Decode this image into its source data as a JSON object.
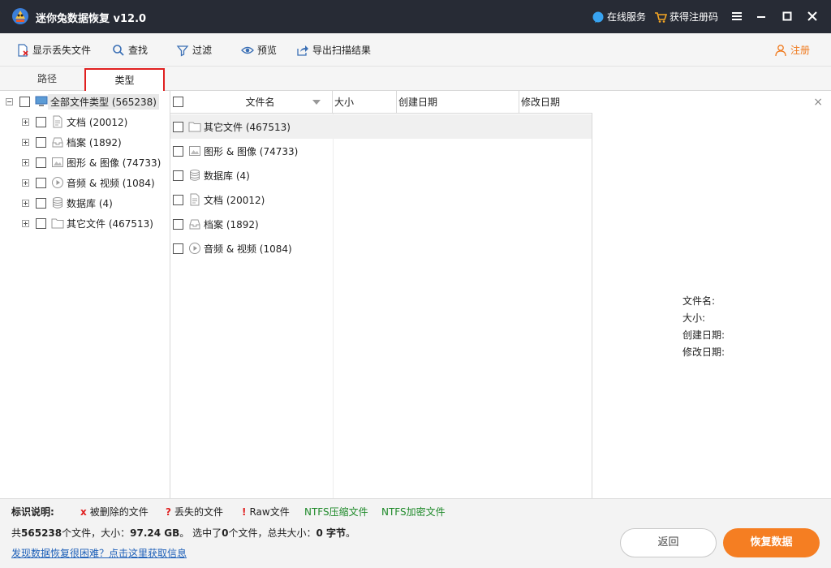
{
  "titlebar": {
    "title": "迷你兔数据恢复 v12.0",
    "online_service": "在线服务",
    "get_code": "获得注册码"
  },
  "toolbar": {
    "show_lost": "显示丢失文件",
    "find": "查找",
    "filter": "过滤",
    "preview": "预览",
    "export": "导出扫描结果",
    "register": "注册"
  },
  "tabs": {
    "path": "路径",
    "type": "类型"
  },
  "tree": {
    "root": "全部文件类型 (565238)",
    "items": [
      {
        "label": "文档 (20012)",
        "icon": "document-icon"
      },
      {
        "label": "档案 (1892)",
        "icon": "archive-icon"
      },
      {
        "label": "图形 & 图像 (74733)",
        "icon": "image-icon"
      },
      {
        "label": "音频 & 视频 (1084)",
        "icon": "media-icon"
      },
      {
        "label": "数据库 (4)",
        "icon": "database-icon"
      },
      {
        "label": "其它文件 (467513)",
        "icon": "folder-icon"
      }
    ]
  },
  "list": {
    "columns": {
      "name": "文件名",
      "size": "大小",
      "created": "创建日期",
      "modified": "修改日期"
    },
    "rows": [
      {
        "label": "其它文件 (467513)",
        "icon": "folder-icon"
      },
      {
        "label": "图形 & 图像 (74733)",
        "icon": "image-icon"
      },
      {
        "label": "数据库 (4)",
        "icon": "database-icon"
      },
      {
        "label": "文档 (20012)",
        "icon": "document-icon"
      },
      {
        "label": "档案 (1892)",
        "icon": "archive-icon"
      },
      {
        "label": "音频 & 视频 (1084)",
        "icon": "media-icon"
      }
    ]
  },
  "info": {
    "close": "×",
    "filename": "文件名:",
    "size": "大小:",
    "created": "创建日期:",
    "modified": "修改日期:"
  },
  "legend": {
    "title": "标识说明:",
    "deleted_mark": "x",
    "deleted": "被删除的文件",
    "lost_mark": "?",
    "lost": "丢失的文件",
    "raw_mark": "!",
    "raw": "Raw文件",
    "ntfs_compressed": "NTFS压缩文件",
    "ntfs_encrypted": "NTFS加密文件"
  },
  "summary": {
    "prefix": "共",
    "file_count": "565238",
    "files_size_label": "个文件，大小：",
    "total_size": "97.24 GB",
    "selected_prefix": "。 选中了",
    "selected_count": "0",
    "selected_mid": "个文件，总共大小：",
    "selected_size": "0 字节",
    "suffix": "。"
  },
  "help_link": "发现数据恢复很困难？点击这里获取信息",
  "buttons": {
    "back": "返回",
    "recover": "恢复数据"
  },
  "colors": {
    "titlebar": "#272b35",
    "accent": "#f57e22",
    "register": "#f07a1e",
    "link": "#1c5fb8",
    "ntfs": "#1f8a2a",
    "mark_red": "#e02020"
  }
}
